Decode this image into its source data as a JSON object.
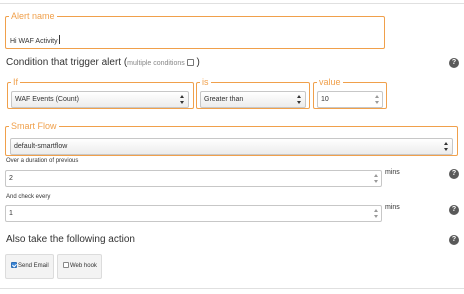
{
  "alert_name": {
    "legend": "Alert name",
    "value": "Hi WAF Activity"
  },
  "condition": {
    "title": "Condition that trigger alert (",
    "paren_text": "multiple conditions",
    "close_paren": ")",
    "if": {
      "legend": "If",
      "selected": "WAF Events (Count)"
    },
    "is": {
      "legend": "is",
      "selected": "Greater than"
    },
    "value": {
      "legend": "value",
      "value": "10"
    }
  },
  "smart_flow": {
    "legend": "Smart Flow",
    "selected": "default-smartflow"
  },
  "duration": {
    "label": "Over a duration of previous",
    "value": "2",
    "unit": "mins"
  },
  "check_every": {
    "label": "And check every",
    "value": "1",
    "unit": "mins"
  },
  "action": {
    "title": "Also take the following action",
    "send_email": {
      "label": "Send Email",
      "checked": true
    },
    "web_hook": {
      "label": "Web hook",
      "checked": false
    }
  },
  "icons": {
    "help": "question-circle-icon"
  },
  "colors": {
    "accent": "#f0a04b",
    "help_icon": "#595959",
    "checkbox_checked": "#3b86d6"
  }
}
